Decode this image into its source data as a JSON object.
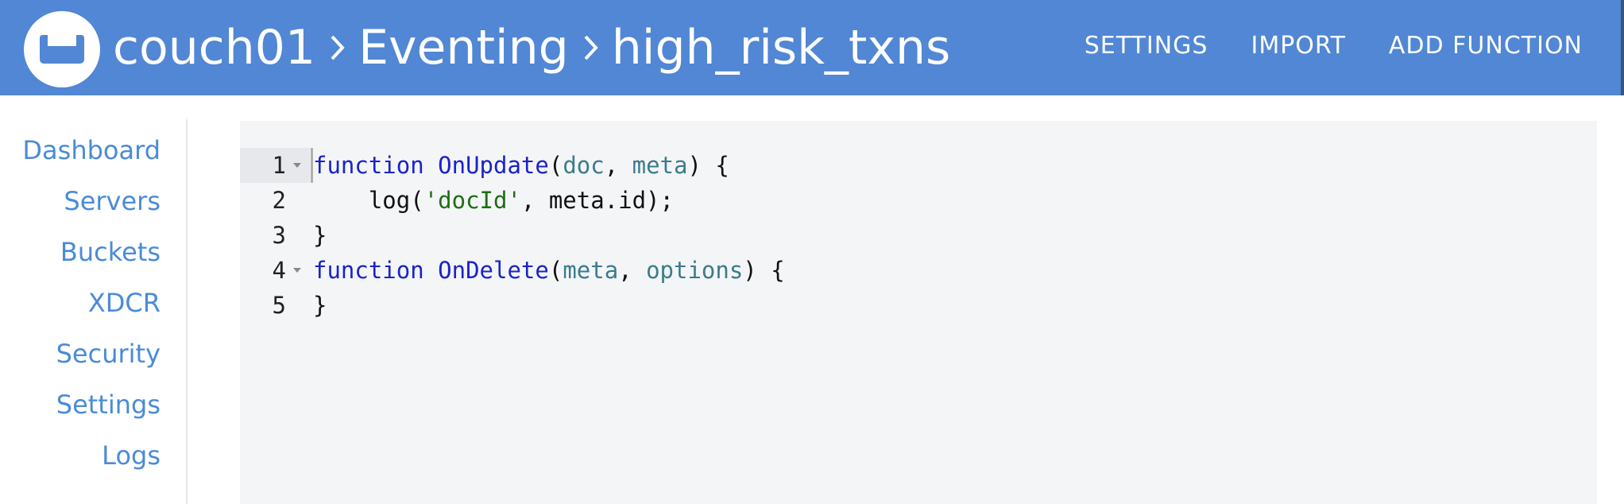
{
  "theme": {
    "accent": "#5187d4",
    "link": "#4a8bd8",
    "keyword": "#1a23c8",
    "param": "#3a7c8c",
    "string": "#1d6e12"
  },
  "header": {
    "logo_icon": "couchbase-logo-icon",
    "breadcrumb": [
      "couch01",
      "Eventing",
      "high_risk_txns"
    ],
    "separator_icon": "chevron-right-icon",
    "nav": {
      "settings": "SETTINGS",
      "import": "IMPORT",
      "add_function": "ADD FUNCTION"
    }
  },
  "sidebar": {
    "items": [
      {
        "label": "Dashboard"
      },
      {
        "label": "Servers"
      },
      {
        "label": "Buckets"
      },
      {
        "label": "XDCR"
      },
      {
        "label": "Security"
      },
      {
        "label": "Settings"
      },
      {
        "label": "Logs"
      }
    ]
  },
  "editor": {
    "lines": [
      {
        "num": "1",
        "foldable": true,
        "tokens": [
          {
            "t": "function",
            "c": "kw"
          },
          {
            "t": " ",
            "c": "plain"
          },
          {
            "t": "OnUpdate",
            "c": "fn"
          },
          {
            "t": "(",
            "c": "plain"
          },
          {
            "t": "doc",
            "c": "param"
          },
          {
            "t": ", ",
            "c": "plain"
          },
          {
            "t": "meta",
            "c": "param"
          },
          {
            "t": ") {",
            "c": "plain"
          }
        ]
      },
      {
        "num": "2",
        "foldable": false,
        "tokens": [
          {
            "t": "    log(",
            "c": "plain"
          },
          {
            "t": "'docId'",
            "c": "str"
          },
          {
            "t": ", meta.id);",
            "c": "plain"
          }
        ]
      },
      {
        "num": "3",
        "foldable": false,
        "tokens": [
          {
            "t": "}",
            "c": "plain"
          }
        ]
      },
      {
        "num": "4",
        "foldable": true,
        "tokens": [
          {
            "t": "function",
            "c": "kw"
          },
          {
            "t": " ",
            "c": "plain"
          },
          {
            "t": "OnDelete",
            "c": "fn"
          },
          {
            "t": "(",
            "c": "plain"
          },
          {
            "t": "meta",
            "c": "param"
          },
          {
            "t": ", ",
            "c": "plain"
          },
          {
            "t": "options",
            "c": "param"
          },
          {
            "t": ") {",
            "c": "plain"
          }
        ]
      },
      {
        "num": "5",
        "foldable": false,
        "tokens": [
          {
            "t": "}",
            "c": "plain"
          }
        ]
      }
    ]
  }
}
